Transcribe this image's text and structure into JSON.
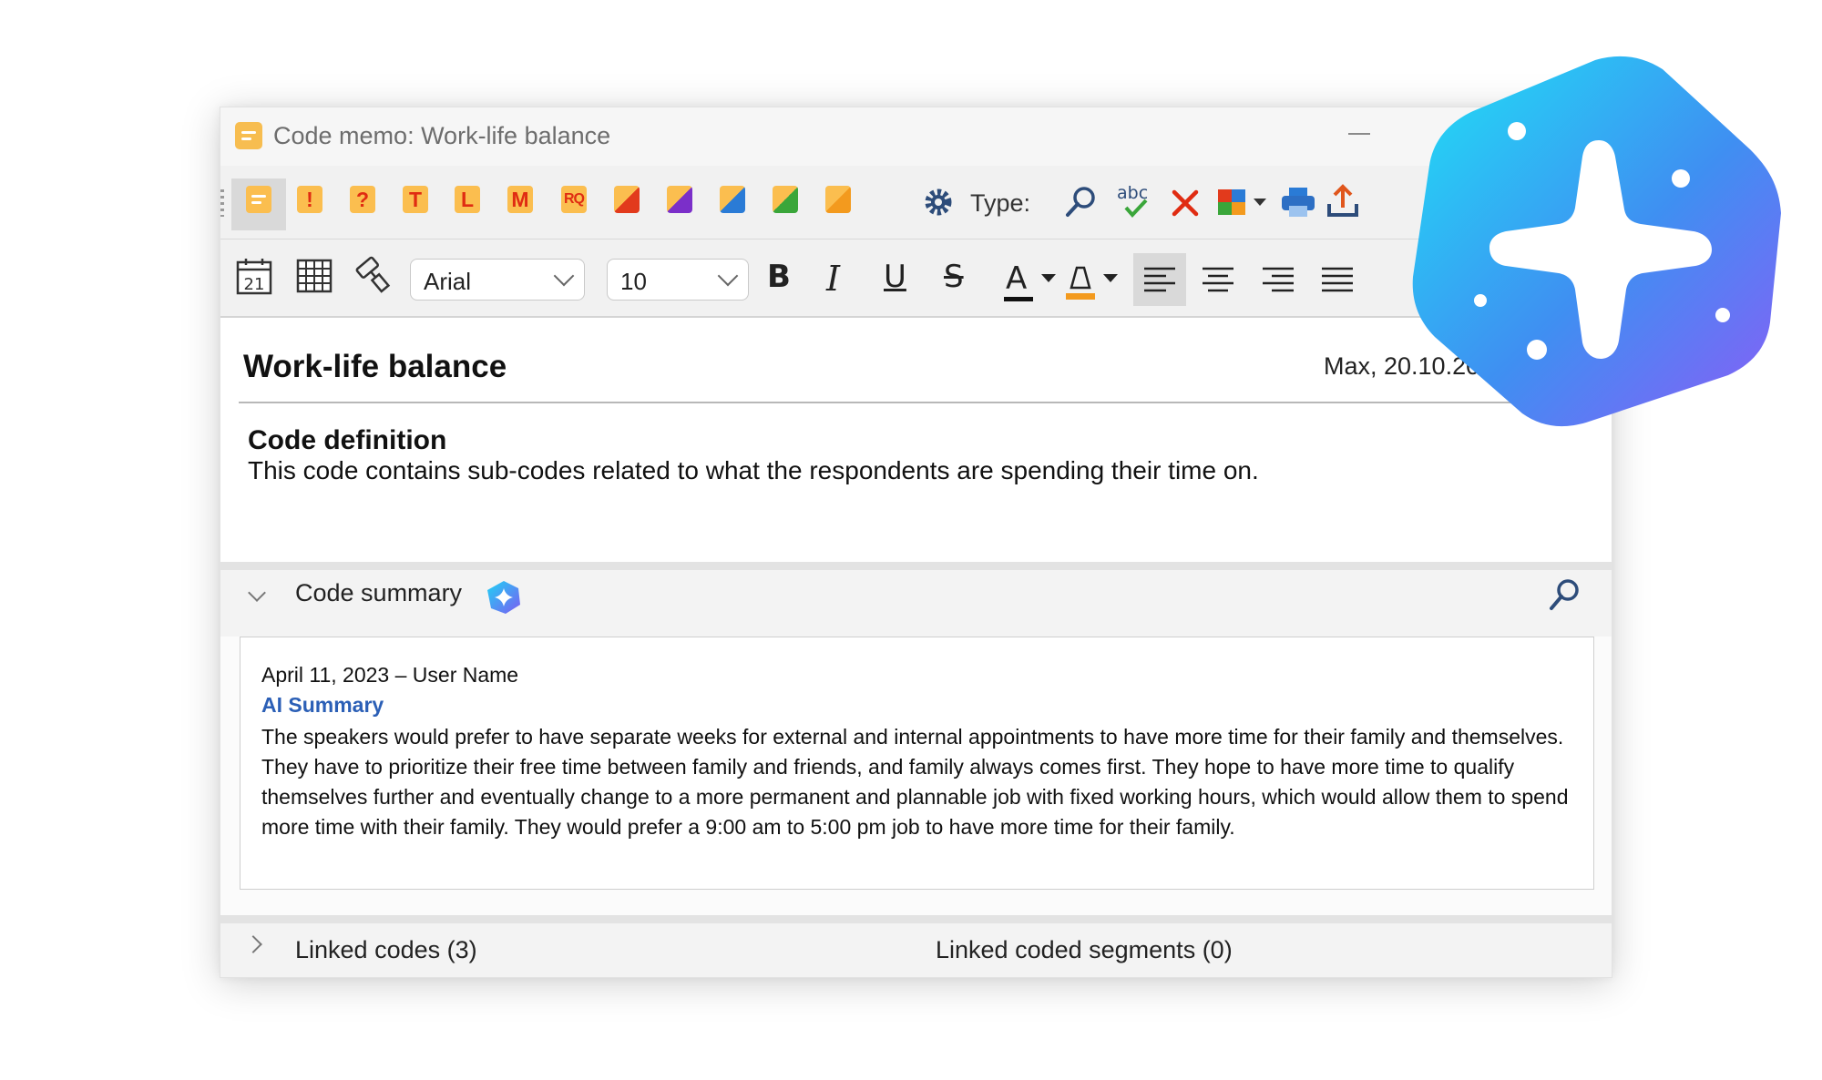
{
  "window": {
    "title": "Code memo: Work-life balance"
  },
  "toolbar": {
    "memo_types": [
      {
        "name": "standard",
        "glyph": ""
      },
      {
        "name": "exclamation",
        "glyph": "!"
      },
      {
        "name": "question",
        "glyph": "?"
      },
      {
        "name": "theory",
        "glyph": "T"
      },
      {
        "name": "literature",
        "glyph": "L"
      },
      {
        "name": "method",
        "glyph": "M"
      },
      {
        "name": "research-question",
        "glyph": "RQ"
      }
    ],
    "type_label": "Type:",
    "more_label": "»"
  },
  "format_bar": {
    "font_name": "Arial",
    "font_size": "10",
    "bold": "B",
    "italic": "I",
    "underline": "U",
    "strike": "S",
    "font_color": "A",
    "date_icon_label": "21"
  },
  "memo": {
    "title": "Work-life balance",
    "author_date": "Max, 20.10.20",
    "definition_heading": "Code definition",
    "definition_text": "This code contains sub-codes related to what the respondents are spending their time on."
  },
  "summary": {
    "label": "Code summary",
    "date_user": "April 11, 2023 – User Name",
    "ai_label": "AI Summary",
    "text": "The speakers would prefer to have separate weeks for external and internal appointments to have more time for their family and themselves. They have to prioritize their free time between family and friends, and family always comes first. They hope to have more time to qualify themselves further and eventually change to a more permanent and plannable job with fixed working hours, which would allow them to spend more time with their family. They would prefer a 9:00 am to 5:00 pm job to have more time for their family."
  },
  "footer": {
    "linked_codes": "Linked codes (3)",
    "linked_segments": "Linked coded segments (0)"
  },
  "colors": {
    "memo_orange": "#fbbe4f",
    "memo_glyph_red": "#e02c12",
    "ai_blue": "#2b5fb6",
    "ai_gradient_start": "#1fe1f5",
    "ai_gradient_end": "#8b5cf6"
  }
}
